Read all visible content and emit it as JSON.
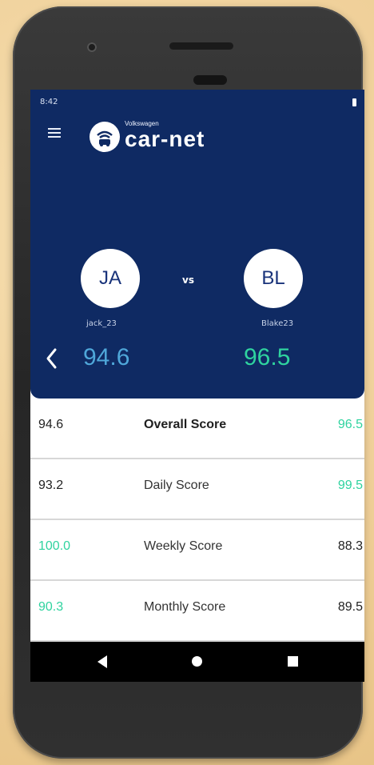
{
  "status": {
    "time": "8:42"
  },
  "brand": {
    "small": "Volkswagen",
    "main": "car-net"
  },
  "players": {
    "left": {
      "initials": "JA",
      "username": "jack_23",
      "score": "94.6"
    },
    "right": {
      "initials": "BL",
      "username": "Blake23",
      "score": "96.5"
    }
  },
  "vs_label": "vs",
  "rows": [
    {
      "left": "94.6",
      "label": "Overall Score",
      "right": "96.5"
    },
    {
      "left": "93.2",
      "label": "Daily Score",
      "right": "99.5"
    },
    {
      "left": "100.0",
      "label": "Weekly Score",
      "right": "88.3"
    },
    {
      "left": "90.3",
      "label": "Monthly Score",
      "right": "89.5"
    }
  ],
  "colors": {
    "header_bg": "#0f2a63",
    "left_accent": "#4fa7d9",
    "right_accent": "#2fd39f"
  },
  "icons": {
    "menu": "hamburger-icon",
    "back": "chevron-left-icon",
    "battery": "battery-icon",
    "nav_back": "back-triangle-icon",
    "nav_home": "home-circle-icon",
    "nav_recent": "recent-square-icon"
  }
}
